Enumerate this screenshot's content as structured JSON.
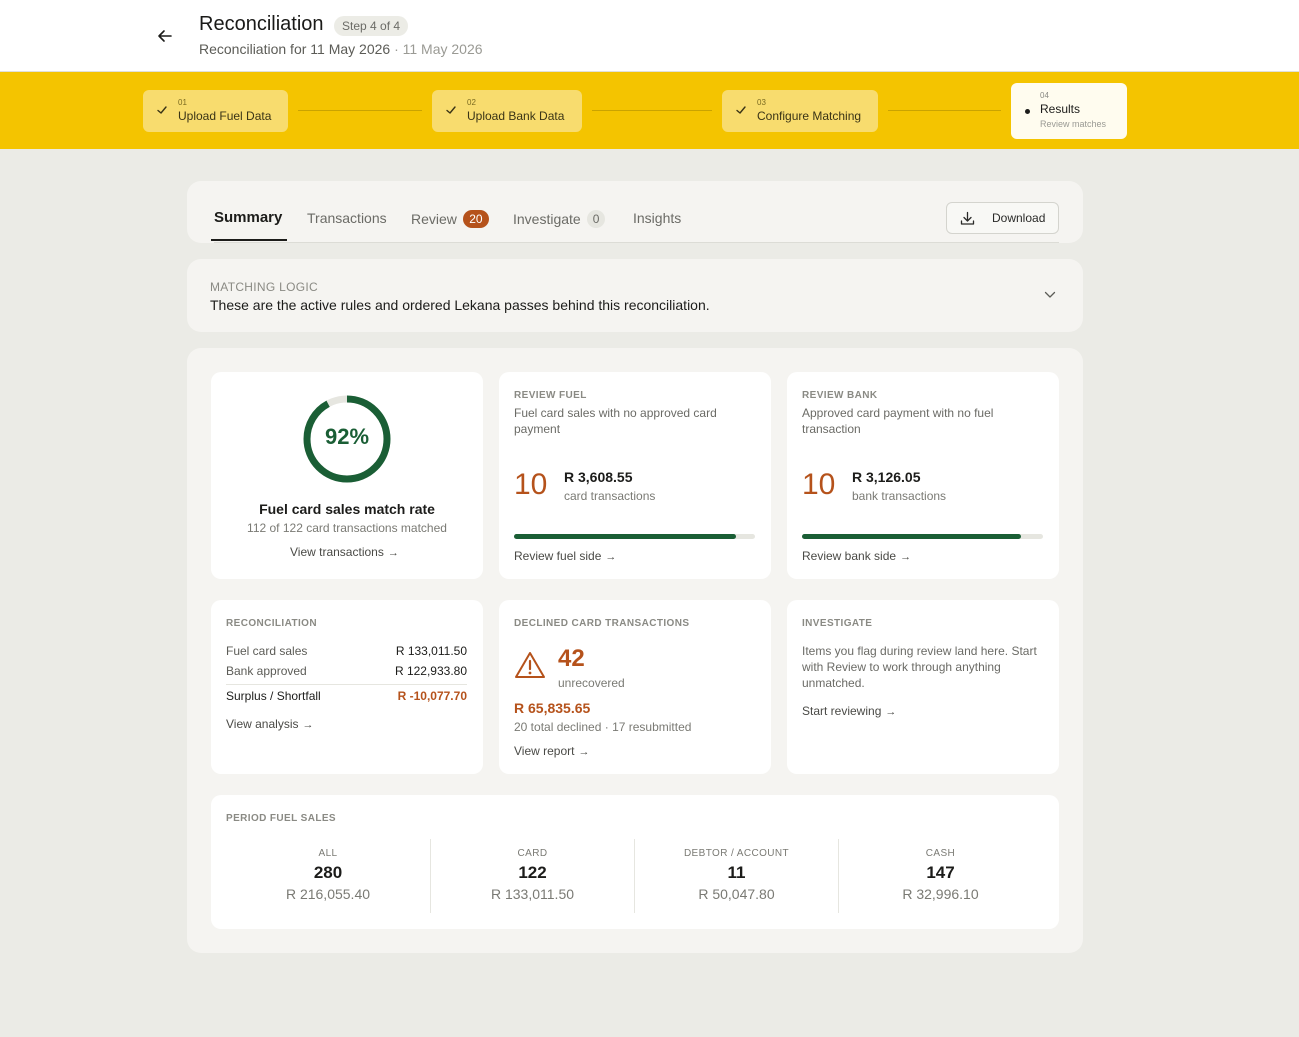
{
  "header": {
    "title": "Reconciliation",
    "step_badge": "Step 4 of 4",
    "subtitle": "Reconciliation for 11 May 2026",
    "subtitle_date": "· 11 May 2026"
  },
  "stepper": {
    "steps": [
      {
        "num": "01",
        "label": "Upload Fuel Data",
        "state": "complete"
      },
      {
        "num": "02",
        "label": "Upload Bank Data",
        "state": "complete"
      },
      {
        "num": "03",
        "label": "Configure Matching",
        "state": "complete"
      },
      {
        "num": "04",
        "label": "Results",
        "sub": "Review matches",
        "state": "active"
      }
    ]
  },
  "tabs": {
    "summary": "Summary",
    "transactions": "Transactions",
    "review": "Review",
    "review_count": "20",
    "investigate": "Investigate",
    "investigate_count": "0",
    "insights": "Insights",
    "download": "Download"
  },
  "logic": {
    "kicker": "MATCHING LOGIC",
    "description": "These are the active rules and ordered Lekana passes behind this reconciliation."
  },
  "match_rate": {
    "percent_label": "92%",
    "rate": 0.92,
    "title": "Fuel card sales match rate",
    "subtitle": "112 of 122 card transactions matched",
    "link": "View transactions"
  },
  "review_fuel": {
    "kicker": "REVIEW FUEL",
    "description": "Fuel card sales with no approved card payment",
    "count": "10",
    "amount": "R 3,608.55",
    "unit": "card transactions",
    "progress": 0.92,
    "link": "Review fuel side"
  },
  "review_bank": {
    "kicker": "REVIEW BANK",
    "description": "Approved card payment with no fuel transaction",
    "count": "10",
    "amount": "R 3,126.05",
    "unit": "bank transactions",
    "progress": 0.91,
    "link": "Review bank side"
  },
  "reconciliation": {
    "kicker": "RECONCILIATION",
    "rows": [
      {
        "label": "Fuel card sales",
        "value": "R 133,011.50"
      },
      {
        "label": "Bank approved",
        "value": "R 122,933.80"
      }
    ],
    "total_label": "Surplus / Shortfall",
    "total_value": "R -10,077.70",
    "link": "View analysis"
  },
  "declined": {
    "kicker": "DECLINED CARD TRANSACTIONS",
    "count": "42",
    "unit": "unrecovered",
    "amount": "R 65,835.65",
    "sub": "20 total declined · 17 resubmitted",
    "link": "View report"
  },
  "investigate": {
    "kicker": "INVESTIGATE",
    "description": "Items you flag during review land here. Start with Review to work through anything unmatched.",
    "link": "Start reviewing"
  },
  "period_sales": {
    "kicker": "PERIOD FUEL SALES",
    "columns": [
      {
        "label": "ALL",
        "count": "280",
        "amount": "R 216,055.40"
      },
      {
        "label": "CARD",
        "count": "122",
        "amount": "R 133,011.50"
      },
      {
        "label": "DEBTOR / ACCOUNT",
        "count": "11",
        "amount": "R 50,047.80"
      },
      {
        "label": "CASH",
        "count": "147",
        "amount": "R 32,996.10"
      }
    ]
  },
  "colors": {
    "accent_yellow": "#f4c400",
    "success_green": "#1a5e35",
    "warning_orange": "#b5521b"
  },
  "icons": {
    "back": "arrow-left-icon",
    "check": "check-icon",
    "download": "download-icon",
    "chevron": "chevron-down-icon",
    "warning": "warning-triangle-icon",
    "link_arrow": "arrow-right-icon"
  }
}
